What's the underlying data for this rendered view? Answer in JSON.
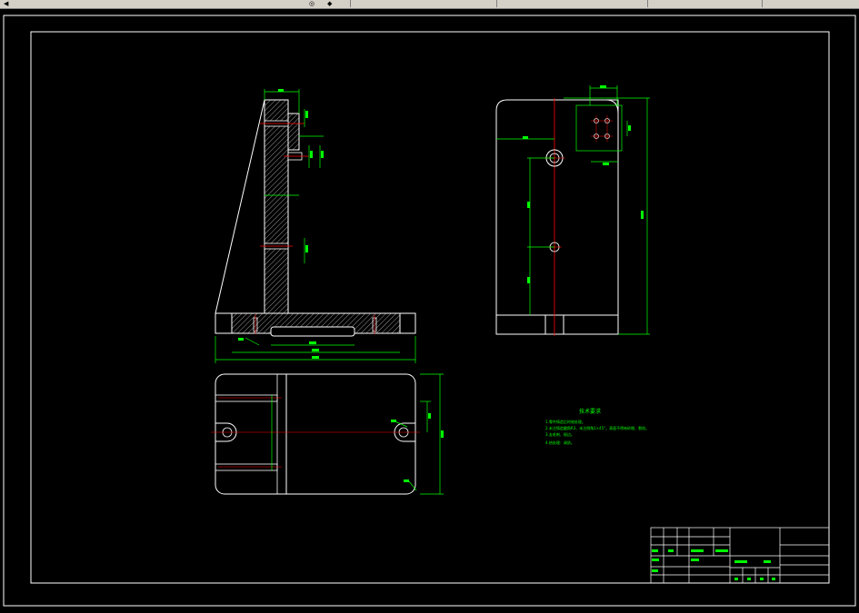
{
  "window": {
    "toolbar_icons": [
      "pointer-icon",
      "zoom-icon",
      "pan-icon"
    ]
  },
  "drawing": {
    "background": "#000000",
    "colors": {
      "outline": "#ffffff",
      "dimension": "#00ff00",
      "center_line": "#ff0000",
      "hatch": "#ffffff",
      "title_block": "#ffffff"
    },
    "tech_requirements_title": "技术要求",
    "tech_requirements": [
      "1.零件铸造后时效处理。",
      "2.未注铸造圆角R3，未注倒角1×45°，表面不得有砂眼、裂纹。",
      "3.去毛刺、锐边。",
      "4.热处理：调质。"
    ]
  }
}
